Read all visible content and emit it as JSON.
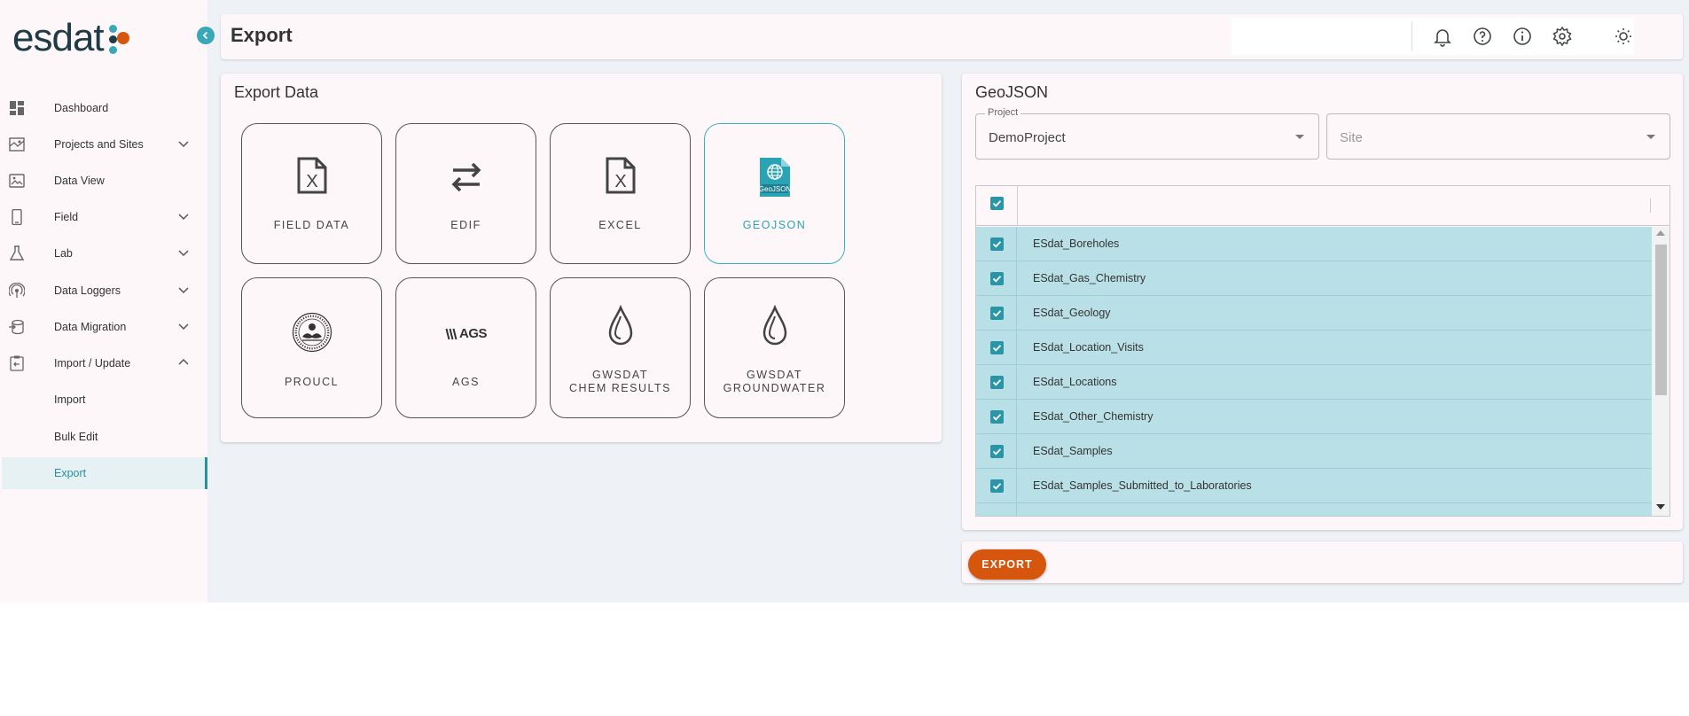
{
  "app": {
    "logo_text": "esdat",
    "colors": {
      "accent": "#2a95a6",
      "brand_orange": "#d7560e",
      "brand_dark": "#1f3b46",
      "selected_row": "#b9e0e6"
    }
  },
  "sidebar": {
    "items": [
      {
        "label": "Dashboard",
        "icon": "dashboard-icon"
      },
      {
        "label": "Projects and Sites",
        "icon": "map-icon",
        "expandable": true
      },
      {
        "label": "Data View",
        "icon": "image-icon"
      },
      {
        "label": "Field",
        "icon": "phone-icon",
        "expandable": true
      },
      {
        "label": "Lab",
        "icon": "flask-icon",
        "expandable": true
      },
      {
        "label": "Data Loggers",
        "icon": "antenna-icon",
        "expandable": true
      },
      {
        "label": "Data Migration",
        "icon": "database-icon",
        "expandable": true
      },
      {
        "label": "Import / Update",
        "icon": "clipboard-icon",
        "expanded": true
      },
      {
        "label": "Import"
      },
      {
        "label": "Bulk Edit"
      },
      {
        "label": "Export",
        "active": true
      }
    ]
  },
  "header": {
    "title": "Export"
  },
  "export_data": {
    "title": "Export Data",
    "tiles": [
      {
        "label": "FIELD DATA",
        "icon": "excel-file-icon"
      },
      {
        "label": "EDIF",
        "icon": "swap-arrows-icon"
      },
      {
        "label": "EXCEL",
        "icon": "excel-file-icon"
      },
      {
        "label": "GEOJSON",
        "icon": "geojson-file-icon",
        "selected": true
      },
      {
        "label": "PROUCL",
        "icon": "epa-seal-icon"
      },
      {
        "label": "AGS",
        "icon": "ags-logo-icon",
        "logo_text": "AGS"
      },
      {
        "label_line1": "GWSDAT",
        "label_line2": "CHEM RESULTS",
        "icon": "droplet-icon"
      },
      {
        "label_line1": "GWSDAT",
        "label_line2": "GROUNDWATER",
        "icon": "droplet-icon"
      }
    ]
  },
  "geojson": {
    "title": "GeoJSON",
    "project": {
      "legend": "Project",
      "value": "DemoProject"
    },
    "site": {
      "placeholder": "Site"
    },
    "tables": [
      "ESdat_Boreholes",
      "ESdat_Gas_Chemistry",
      "ESdat_Geology",
      "ESdat_Location_Visits",
      "ESdat_Locations",
      "ESdat_Other_Chemistry",
      "ESdat_Samples",
      "ESdat_Samples_Submitted_to_Laboratories"
    ],
    "export_label": "EXPORT"
  }
}
